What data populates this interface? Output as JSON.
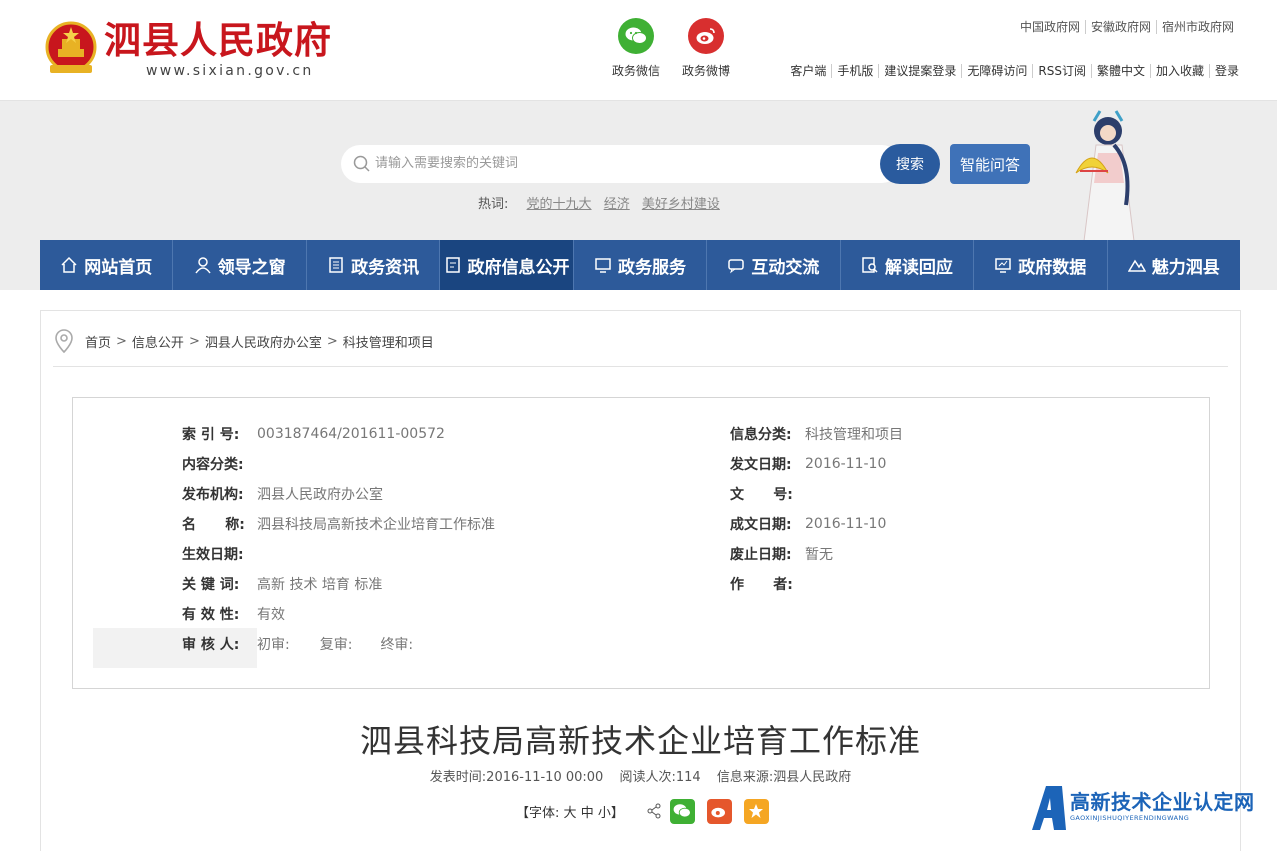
{
  "header": {
    "site_name": "泗县人民政府",
    "site_url": "www.sixian.gov.cn",
    "social": [
      {
        "label": "政务微信",
        "icon": "wechat-icon"
      },
      {
        "label": "政务微博",
        "icon": "weibo-icon"
      }
    ],
    "top_links": [
      "中国政府网",
      "安徽政府网",
      "宿州市政府网"
    ],
    "util_links": [
      "客户端",
      "手机版",
      "建议提案登录",
      "无障碍访问",
      "RSS订阅",
      "繁體中文",
      "加入收藏",
      "登录"
    ]
  },
  "search": {
    "placeholder": "请输入需要搜索的关键词",
    "button": "搜索",
    "ai_button": "智能问答",
    "hot_label": "热词:",
    "hot_words": [
      "党的十九大",
      "经济",
      "美好乡村建设"
    ]
  },
  "nav": {
    "items": [
      {
        "label": "网站首页",
        "icon": "home-icon"
      },
      {
        "label": "领导之窗",
        "icon": "person-icon"
      },
      {
        "label": "政务资讯",
        "icon": "news-icon"
      },
      {
        "label": "政府信息公开",
        "icon": "document-icon"
      },
      {
        "label": "政务服务",
        "icon": "monitor-icon"
      },
      {
        "label": "互动交流",
        "icon": "chat-icon"
      },
      {
        "label": "解读回应",
        "icon": "search-doc-icon"
      },
      {
        "label": "政府数据",
        "icon": "chart-icon"
      },
      {
        "label": "魅力泗县",
        "icon": "mountain-icon"
      }
    ],
    "active_index": 3
  },
  "breadcrumb": [
    "首页",
    "信息公开",
    "泗县人民政府办公室",
    "科技管理和项目"
  ],
  "meta": {
    "index_no": {
      "key": "索 引 号:",
      "value": "003187464/201611-00572"
    },
    "category": {
      "key": "信息分类:",
      "value": "科技管理和项目"
    },
    "content_type": {
      "key": "内容分类:",
      "value": ""
    },
    "issue_date": {
      "key": "发文日期:",
      "value": "2016-11-10"
    },
    "publisher": {
      "key": "发布机构:",
      "value": "泗县人民政府办公室"
    },
    "doc_no": {
      "key": "文      号:",
      "value": ""
    },
    "name": {
      "key": "名      称:",
      "value": "泗县科技局高新技术企业培育工作标准"
    },
    "create_date": {
      "key": "成文日期:",
      "value": "2016-11-10"
    },
    "effective_date": {
      "key": "生效日期:",
      "value": ""
    },
    "expire_date": {
      "key": "废止日期:",
      "value": "暂无"
    },
    "keywords": {
      "key": "关 键 词:",
      "value": "高新 技术 培育 标准"
    },
    "author": {
      "key": "作      者:",
      "value": ""
    },
    "validity": {
      "key": "有 效 性:",
      "value": "有效"
    },
    "reviewer": {
      "key": "审 核 人:",
      "first": "初审:",
      "second": "复审:",
      "final": "终审:"
    }
  },
  "article": {
    "title": "泗县科技局高新技术企业培育工作标准",
    "published": "发表时间:2016-11-10 00:00",
    "views": "阅读人次:114",
    "source": "信息来源:泗县人民政府",
    "font_label": "【字体:",
    "font_large": "大",
    "font_medium": "中",
    "font_small": "小",
    "font_end": "】"
  },
  "watermark": {
    "text": "高新技术企业认定网",
    "sub": "GAOXINJISHUQIYERENDINGWANG"
  },
  "colors": {
    "brand_red": "#c8161d",
    "nav_blue": "#2d5a9a",
    "nav_active": "#1a4580",
    "search_blue": "#2a5b9e"
  }
}
